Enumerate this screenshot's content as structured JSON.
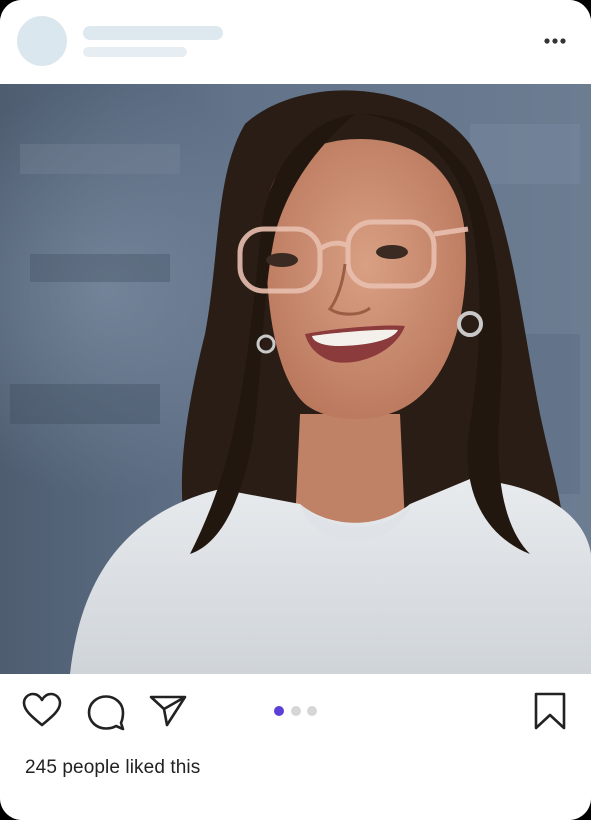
{
  "post": {
    "likes_text": "245 people liked this",
    "carousel": {
      "count": 3,
      "active_index": 0
    },
    "colors": {
      "active_dot": "#5b3fd6",
      "inactive_dot": "#d6d6d6",
      "placeholder": "#dde8ef",
      "icon_stroke": "#222222"
    },
    "icons": {
      "more": "more-horizontal-icon",
      "like": "heart-icon",
      "comment": "comment-bubble-icon",
      "share": "send-paper-plane-icon",
      "save": "bookmark-icon"
    }
  }
}
